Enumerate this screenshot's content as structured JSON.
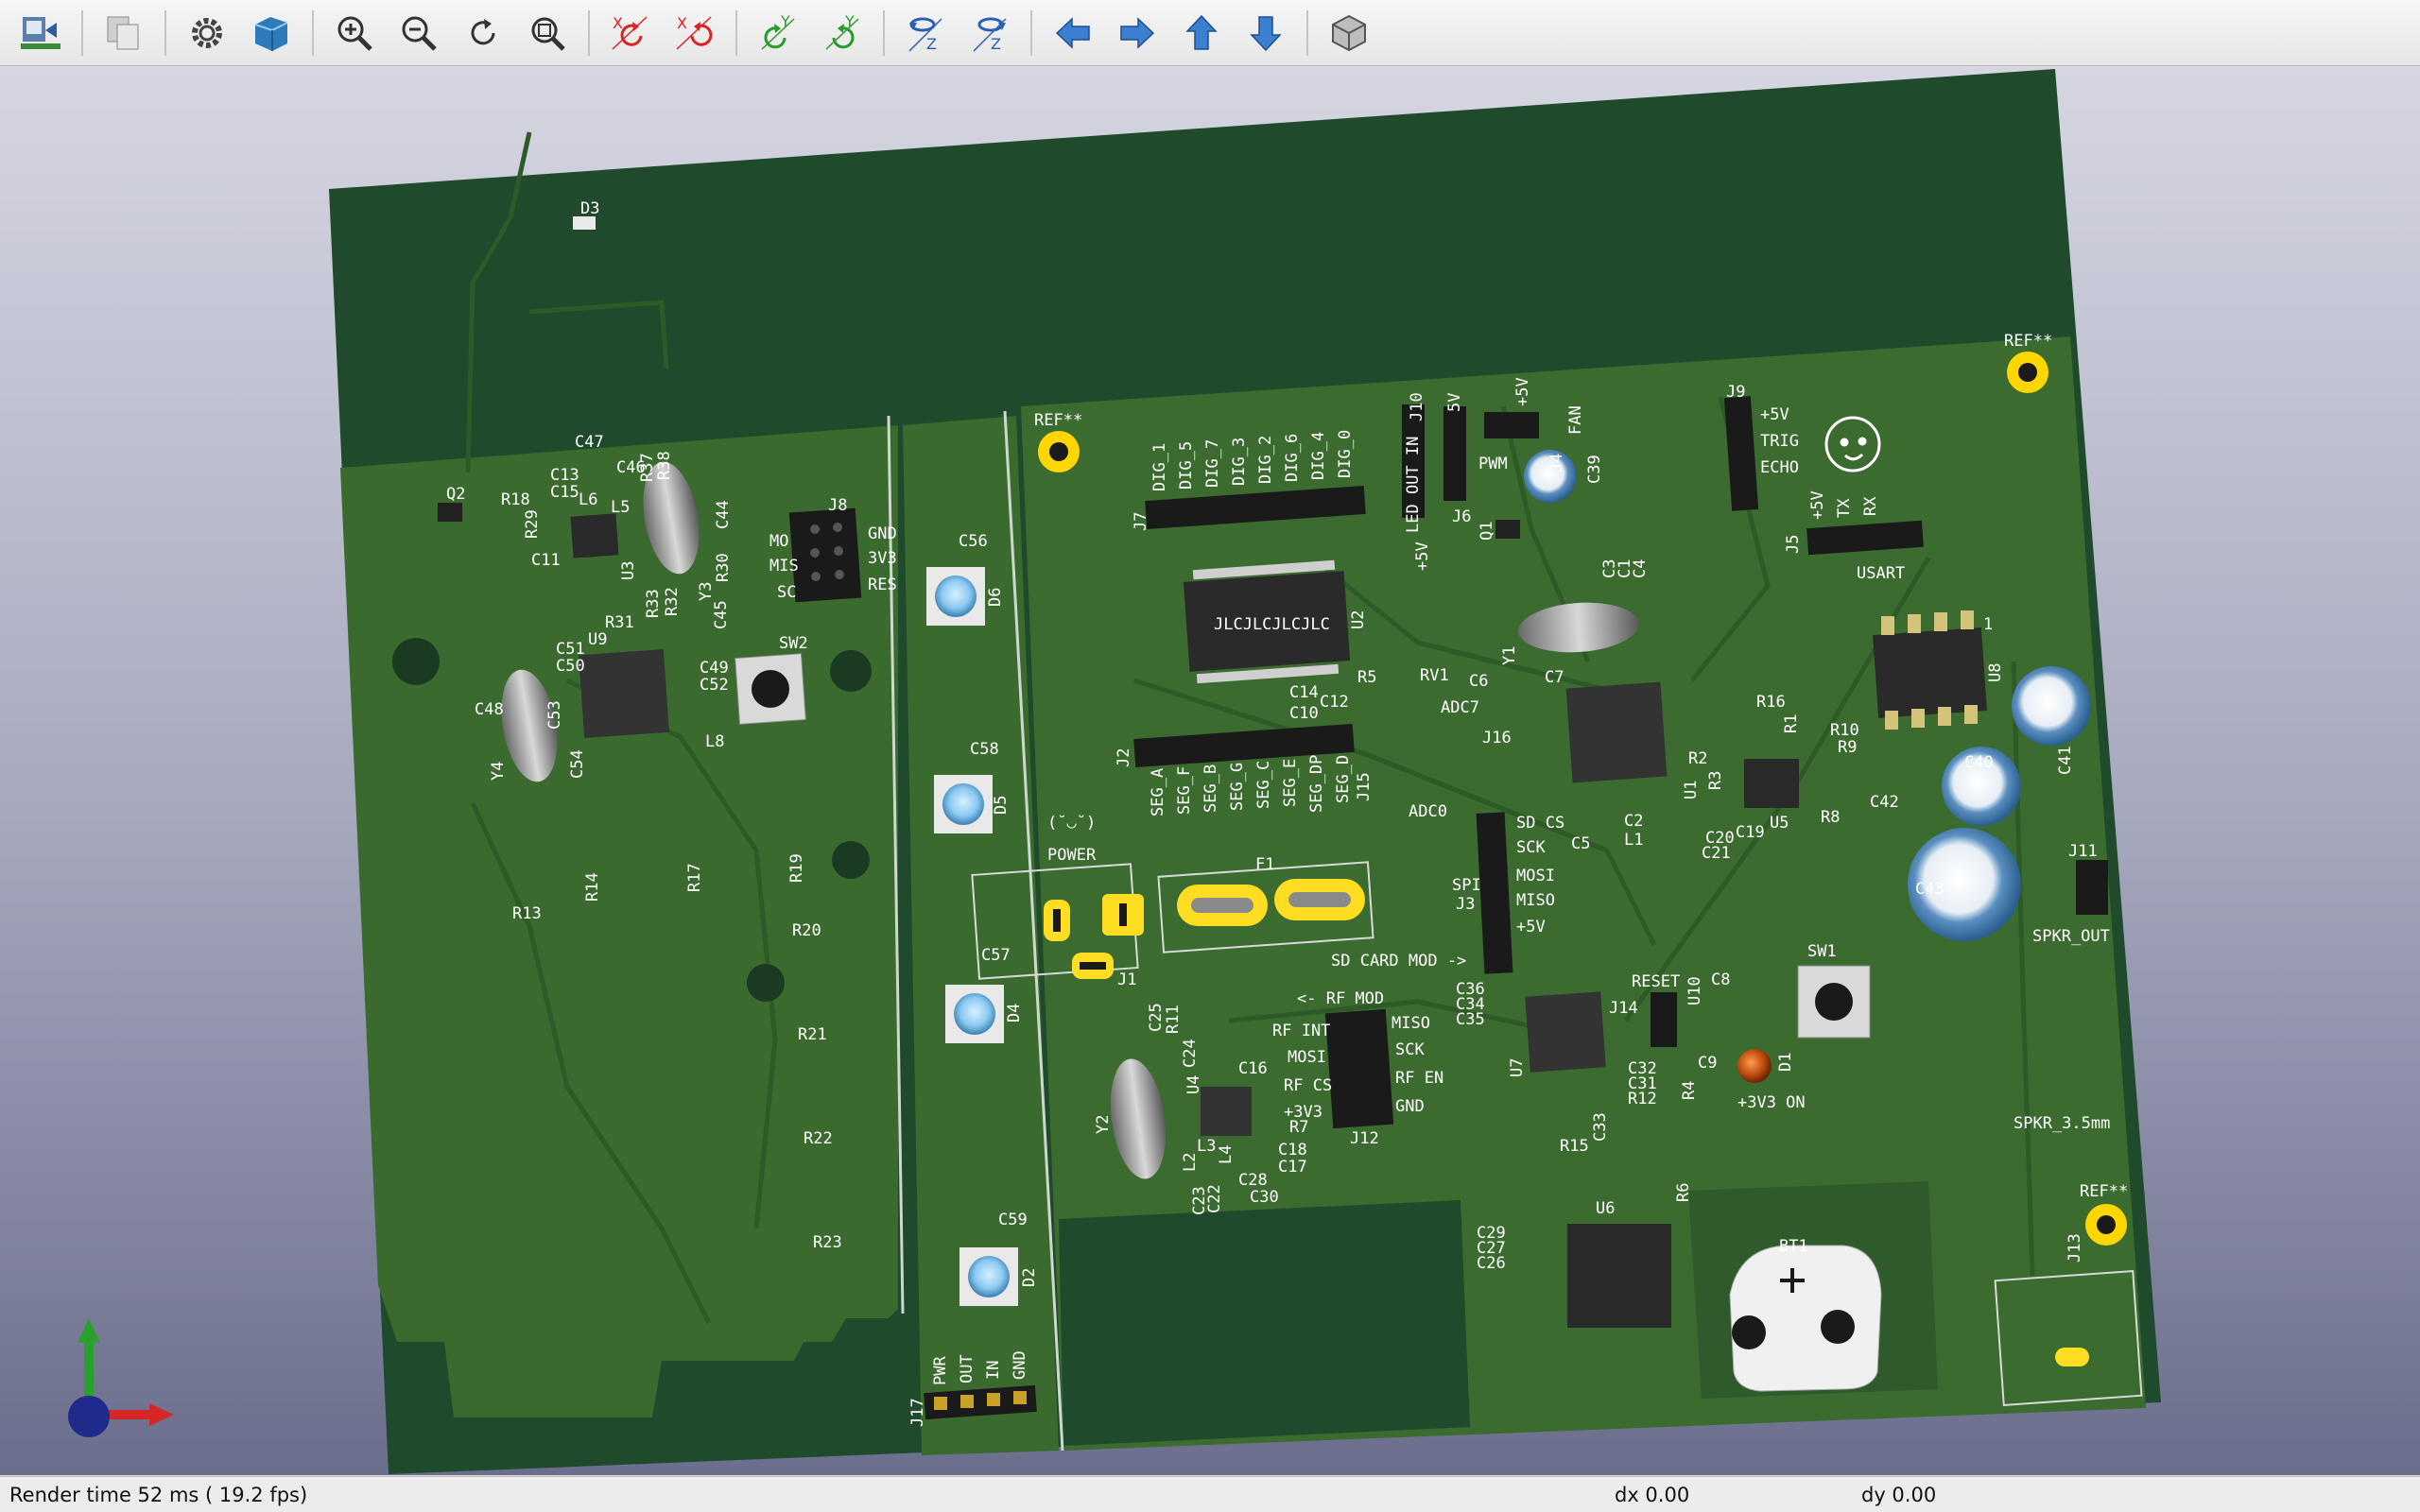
{
  "toolbar": {
    "buttons": [
      {
        "name": "reload-board-icon"
      },
      {
        "name": "copy-image-icon"
      },
      {
        "name": "settings-icon"
      },
      {
        "name": "raytracing-icon"
      },
      {
        "name": "zoom-in-icon"
      },
      {
        "name": "zoom-out-icon"
      },
      {
        "name": "redraw-icon"
      },
      {
        "name": "zoom-fit-icon"
      },
      {
        "name": "rotate-x-cw-icon"
      },
      {
        "name": "rotate-x-ccw-icon"
      },
      {
        "name": "rotate-y-cw-icon"
      },
      {
        "name": "rotate-y-ccw-icon"
      },
      {
        "name": "rotate-z-cw-icon"
      },
      {
        "name": "rotate-z-ccw-icon"
      },
      {
        "name": "move-left-icon"
      },
      {
        "name": "move-right-icon"
      },
      {
        "name": "move-up-icon"
      },
      {
        "name": "move-down-icon"
      },
      {
        "name": "ortho-view-icon"
      }
    ]
  },
  "board": {
    "labels": {
      "d3": "D3",
      "q2": "Q2",
      "r18": "R18",
      "c47": "C47",
      "c13": "C13",
      "c15": "C15",
      "c46": "C46",
      "l6": "L6",
      "l5": "L5",
      "r29": "R29",
      "c11": "C11",
      "u3": "U3",
      "r30": "R30",
      "c44": "C44",
      "c45": "C45",
      "y3": "Y3",
      "r33": "R33",
      "r32": "R32",
      "r37": "R37",
      "r38": "R38",
      "j8": "J8",
      "j8_gnd": "GND",
      "j8_3v3": "3V3",
      "j8_res": "RES",
      "j8_mo": "MO",
      "j8_mis": "MIS",
      "j8_sc": "SC",
      "r31": "R31",
      "u9": "U9",
      "c51": "C51",
      "c50": "C50",
      "c49": "C49",
      "c52": "C52",
      "sw2": "SW2",
      "c48": "C48",
      "y4": "Y4",
      "c53": "C53",
      "c54": "C54",
      "l8": "L8",
      "r14": "R14",
      "r17": "R17",
      "r19": "R19",
      "r13": "R13",
      "r20": "R20",
      "r21": "R21",
      "r22": "R22",
      "r23": "R23",
      "c56": "C56",
      "d6": "D6",
      "c58": "C58",
      "d5": "D5",
      "c57": "C57",
      "d4": "D4",
      "c59": "C59",
      "d2": "D2",
      "j17": "J17",
      "j17_pwr": "PWR",
      "j17_out": "OUT",
      "j17_in": "IN",
      "j17_gnd": "GND",
      "ref1": "REF**",
      "ref2": "REF**",
      "ref3": "REF**",
      "j7": "J7",
      "dig": [
        "DIG_1",
        "DIG_5",
        "DIG_7",
        "DIG_3",
        "DIG_2",
        "DIG_6",
        "DIG_4",
        "DIG_0"
      ],
      "jlc": "JLCJLCJLCJLC",
      "u2": "U2",
      "j2": "J2",
      "seg": [
        "SEG_A",
        "SEG_F",
        "SEG_B",
        "SEG_G",
        "SEG_C",
        "SEG_E",
        "SEG_DP",
        "SEG_D"
      ],
      "c14": "C14",
      "c10": "C10",
      "c12": "C12",
      "r5": "R5",
      "rv1": "RV1",
      "c6": "C6",
      "adc7": "ADC7",
      "j16": "J16",
      "j15": "J15",
      "adc0": "ADC0",
      "power": "POWER",
      "face": "(˘◡˘)",
      "j10": "J10",
      "led_out_in": "LED OUT IN",
      "plus5v_a": "+5V",
      "j6": "J6",
      "pwm": "PWM",
      "plus5v_b": "5V",
      "j4": "J4",
      "fan": "FAN",
      "plus5v_c": "+5V",
      "c39": "C39",
      "q1": "Q1",
      "y1": "Y1",
      "c7": "C7",
      "c3": "C3",
      "c1": "C1",
      "c4": "C4",
      "j9": "J9",
      "j9_5v": "+5V",
      "j9_trig": "TRIG",
      "j9_echo": "ECHO",
      "j5": "J5",
      "j5_5v": "+5V",
      "j5_tx": "TX",
      "j5_rx": "RX",
      "usart": "USART",
      "u8": "U8",
      "u8_pin1": "1",
      "r16": "R16",
      "r1": "R1",
      "r10": "R10",
      "r9": "R9",
      "c41": "C41",
      "c40": "C40",
      "r2": "R2",
      "u1": "U1",
      "r3": "R3",
      "u5": "U5",
      "r8": "R8",
      "c19": "C19",
      "c20": "C20",
      "c21": "C21",
      "c2": "C2",
      "l1": "L1",
      "c5": "C5",
      "c42": "C42",
      "c43": "C43",
      "j11": "J11",
      "spkr_out": "SPKR_OUT",
      "f1": "F1",
      "j1": "J1",
      "sd_card_mod": "SD CARD MOD ->",
      "j3": "J3",
      "spi": "SPI",
      "sd_cs": "SD CS",
      "sck": "SCK",
      "mosi": "MOSI",
      "miso": "MISO",
      "plus5v_d": "+5V",
      "c36": "C36",
      "c34": "C34",
      "c35": "C35",
      "u7": "U7",
      "j14": "J14",
      "reset": "RESET",
      "u10": "U10",
      "c8": "C8",
      "sw1": "SW1",
      "c9": "C9",
      "d1": "D1",
      "r4": "R4",
      "plus3v3_on": "+3V3 ON",
      "c32": "C32",
      "c31": "C31",
      "r12": "R12",
      "c33": "C33",
      "r15": "R15",
      "rf_mod": "<- RF MOD",
      "rf_int": "RF INT",
      "rf_mosi": "MOSI",
      "rf_cs": "RF CS",
      "rf_3v3": "+3V3",
      "rf_miso": "MISO",
      "rf_sck": "SCK",
      "rf_en": "RF EN",
      "rf_gnd": "GND",
      "j12": "J12",
      "c25": "C25",
      "r11": "R11",
      "c24": "C24",
      "c16": "C16",
      "u4": "U4",
      "y2": "Y2",
      "r7": "R7",
      "c18": "C18",
      "c17": "C17",
      "l2": "L2",
      "l3": "L3",
      "l4": "L4",
      "c23": "C23",
      "c22": "C22",
      "c28": "C28",
      "c30": "C30",
      "u6": "U6",
      "r6": "R6",
      "c29": "C29",
      "c27": "C27",
      "c26": "C26",
      "bt1": "BT1",
      "spkr_35": "SPKR_3.5mm",
      "j13": "J13"
    }
  },
  "status": {
    "render_time": "Render time 52 ms ( 19.2 fps)",
    "dx": "dx 0.00",
    "dy": "dy 0.00"
  }
}
